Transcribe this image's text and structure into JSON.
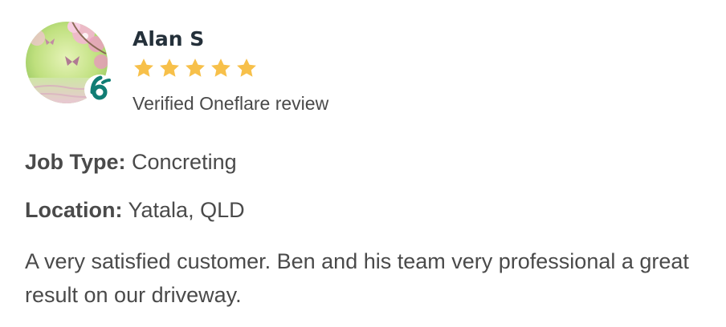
{
  "reviewer": {
    "name": "Alan S",
    "avatar": "butterfly-flowers-photo",
    "badge_icon": "oneflare-logo-icon",
    "rating": 5,
    "rating_max": 5,
    "verified_text": "Verified Oneflare review"
  },
  "details": {
    "job_type_label": "Job Type:",
    "job_type_value": "Concreting",
    "location_label": "Location:",
    "location_value": "Yatala, QLD"
  },
  "review_text": "A very satisfied customer. Ben and his team very professional a great result on our driveway.",
  "colors": {
    "star": "#f7c04a",
    "brand_teal": "#107d74",
    "name": "#24303a",
    "body": "#4a4a4a"
  }
}
